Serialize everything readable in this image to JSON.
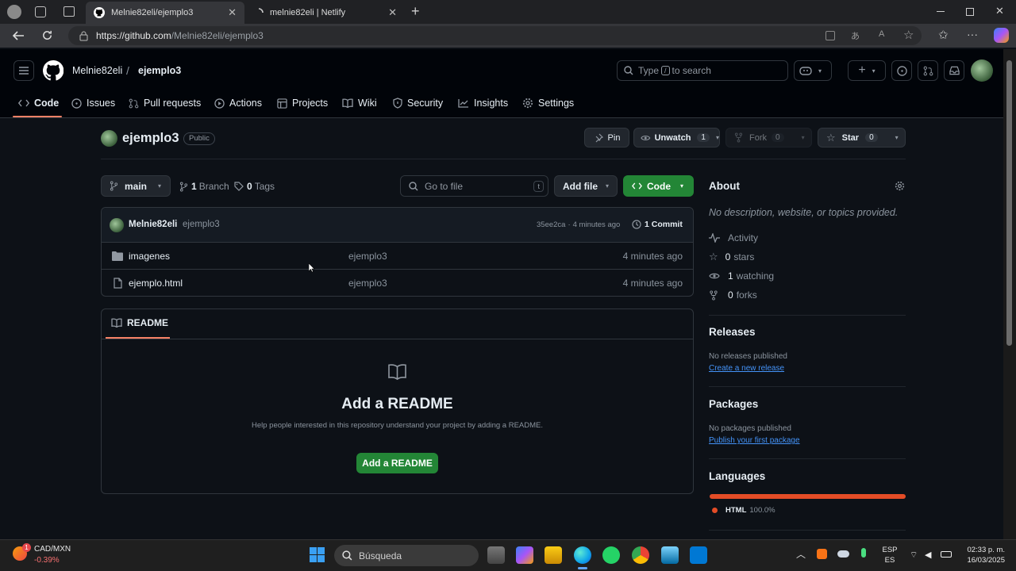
{
  "browser": {
    "tabs": [
      {
        "title": "Melnie82eli/ejemplo3",
        "active": true
      },
      {
        "title": "melnie82eli | Netlify",
        "active": false
      }
    ],
    "url_host": "https://github.com",
    "url_path": "/Melnie82eli/ejemplo3"
  },
  "header": {
    "owner": "Melnie82eli",
    "separator": "/",
    "repo": "ejemplo3",
    "search_prefix": "Type",
    "search_key": "/",
    "search_suffix": "to search"
  },
  "nav": {
    "tabs": [
      "Code",
      "Issues",
      "Pull requests",
      "Actions",
      "Projects",
      "Wiki",
      "Security",
      "Insights",
      "Settings"
    ]
  },
  "repo": {
    "name": "ejemplo3",
    "visibility": "Public",
    "pin_label": "Pin",
    "unwatch_label": "Unwatch",
    "unwatch_count": "1",
    "fork_label": "Fork",
    "fork_count": "0",
    "star_label": "Star",
    "star_count": "0"
  },
  "toolbar": {
    "branch": "main",
    "branch_count": "1",
    "branch_label": "Branch",
    "tag_count": "0",
    "tag_label": "Tags",
    "goto_placeholder": "Go to file",
    "goto_key": "t",
    "add_file_label": "Add file",
    "code_label": "Code"
  },
  "commit": {
    "author": "Melnie82eli",
    "message": "ejemplo3",
    "hash": "35ee2ca",
    "dot": "·",
    "time": "4 minutes ago",
    "count_label": "1 Commit"
  },
  "files": [
    {
      "name": "imagenes",
      "type": "folder",
      "message": "ejemplo3",
      "time": "4 minutes ago"
    },
    {
      "name": "ejemplo.html",
      "type": "file",
      "message": "ejemplo3",
      "time": "4 minutes ago"
    }
  ],
  "readme": {
    "tab_label": "README",
    "title": "Add a README",
    "description": "Help people interested in this repository understand your project by adding a README.",
    "button_label": "Add a README"
  },
  "about": {
    "heading": "About",
    "description": "No description, website, or topics provided.",
    "activity": "Activity",
    "stars_count": "0",
    "stars_label": "stars",
    "watching_count": "1",
    "watching_label": "watching",
    "forks_count": "0",
    "forks_label": "forks"
  },
  "releases": {
    "heading": "Releases",
    "text": "No releases published",
    "link": "Create a new release"
  },
  "packages": {
    "heading": "Packages",
    "text": "No packages published",
    "link": "Publish your first package"
  },
  "languages": {
    "heading": "Languages",
    "name": "HTML",
    "percent": "100.0%",
    "color": "#e34c26",
    "fraction": 1.0
  },
  "taskbar": {
    "widget_title": "CAD/MXN",
    "widget_value": "-0.39%",
    "widget_badge": "1",
    "search_label": "Búsqueda",
    "lang_top": "ESP",
    "lang_bottom": "ES",
    "time": "02:33 p. m.",
    "date": "16/03/2025"
  },
  "colors": {
    "accent_green": "#238636",
    "link_blue": "#4493f8",
    "tab_underline": "#f78166",
    "bg": "#0d1117"
  }
}
